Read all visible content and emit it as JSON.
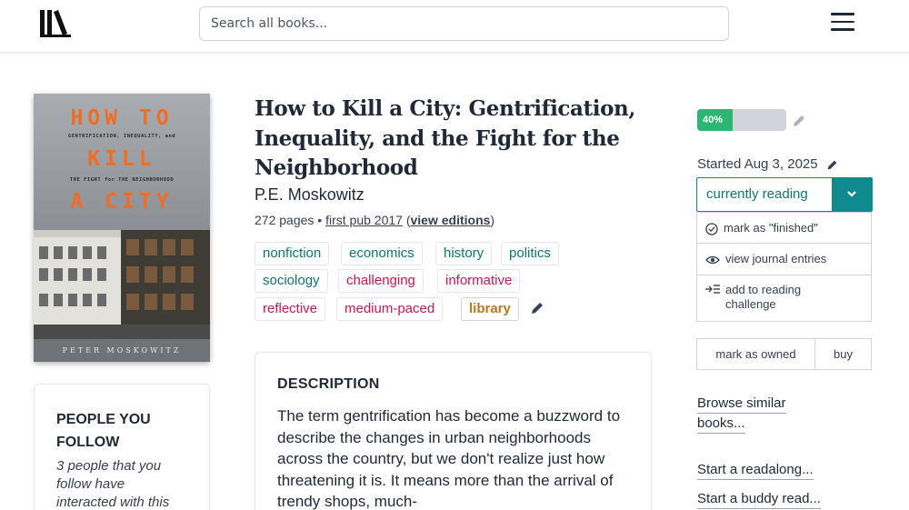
{
  "header": {
    "search_placeholder": "Search all books...",
    "logo_icon": "library-books-logo-icon",
    "menu_icon": "hamburger-menu-icon"
  },
  "cover": {
    "line1": "HOW TO",
    "subtitle1": "GENTRIFICATION, INEQUALITY, and",
    "line2": "KILL",
    "subtitle2": "THE FIGHT for THE NEIGHBORHOOD",
    "line3": "A CITY",
    "author": "PETER MOSKOWITZ"
  },
  "people_you_follow": {
    "heading": "PEOPLE YOU FOLLOW",
    "text": "3 people that you follow have interacted with this"
  },
  "book": {
    "title": "How to Kill a City: Gentrification, Inequality, and the Fight for the Neighborhood",
    "author": "P.E. Moskowitz",
    "pages": "272 pages",
    "separator": "•",
    "first_pub": "first pub 2017",
    "open_paren": "(",
    "view_editions": "view editions",
    "close_paren": ")"
  },
  "tags": [
    "nonfiction",
    "economics",
    "history",
    "politics",
    "sociology",
    "challenging",
    "informative",
    "reflective",
    "medium-paced",
    "library"
  ],
  "description": {
    "heading": "DESCRIPTION",
    "text": "The term gentrification has become a buzzword to describe the changes in urban neighborhoods across the country, but we don't realize just how threatening it is. It means more than the arrival of trendy shops, much-"
  },
  "reading": {
    "progress_label": "40%",
    "progress_fraction": 0.4,
    "started_label": "Started Aug 3, 2025",
    "status": "currently reading",
    "options": [
      "mark as \"finished\"",
      "view journal entries",
      "add to reading challenge"
    ],
    "mark_owned": "mark as owned",
    "buy": "buy"
  },
  "links": {
    "browse_similar": [
      "Browse similar",
      "books..."
    ],
    "readalong": "Start a readalong...",
    "buddy_read": "Start a buddy read..."
  },
  "colors": {
    "accent_teal": "#0f8b8d",
    "progress_green": "#2bb673",
    "tag_teal": "#0f766e",
    "tag_pink": "#c2185b",
    "tag_library": "#b7791f"
  }
}
